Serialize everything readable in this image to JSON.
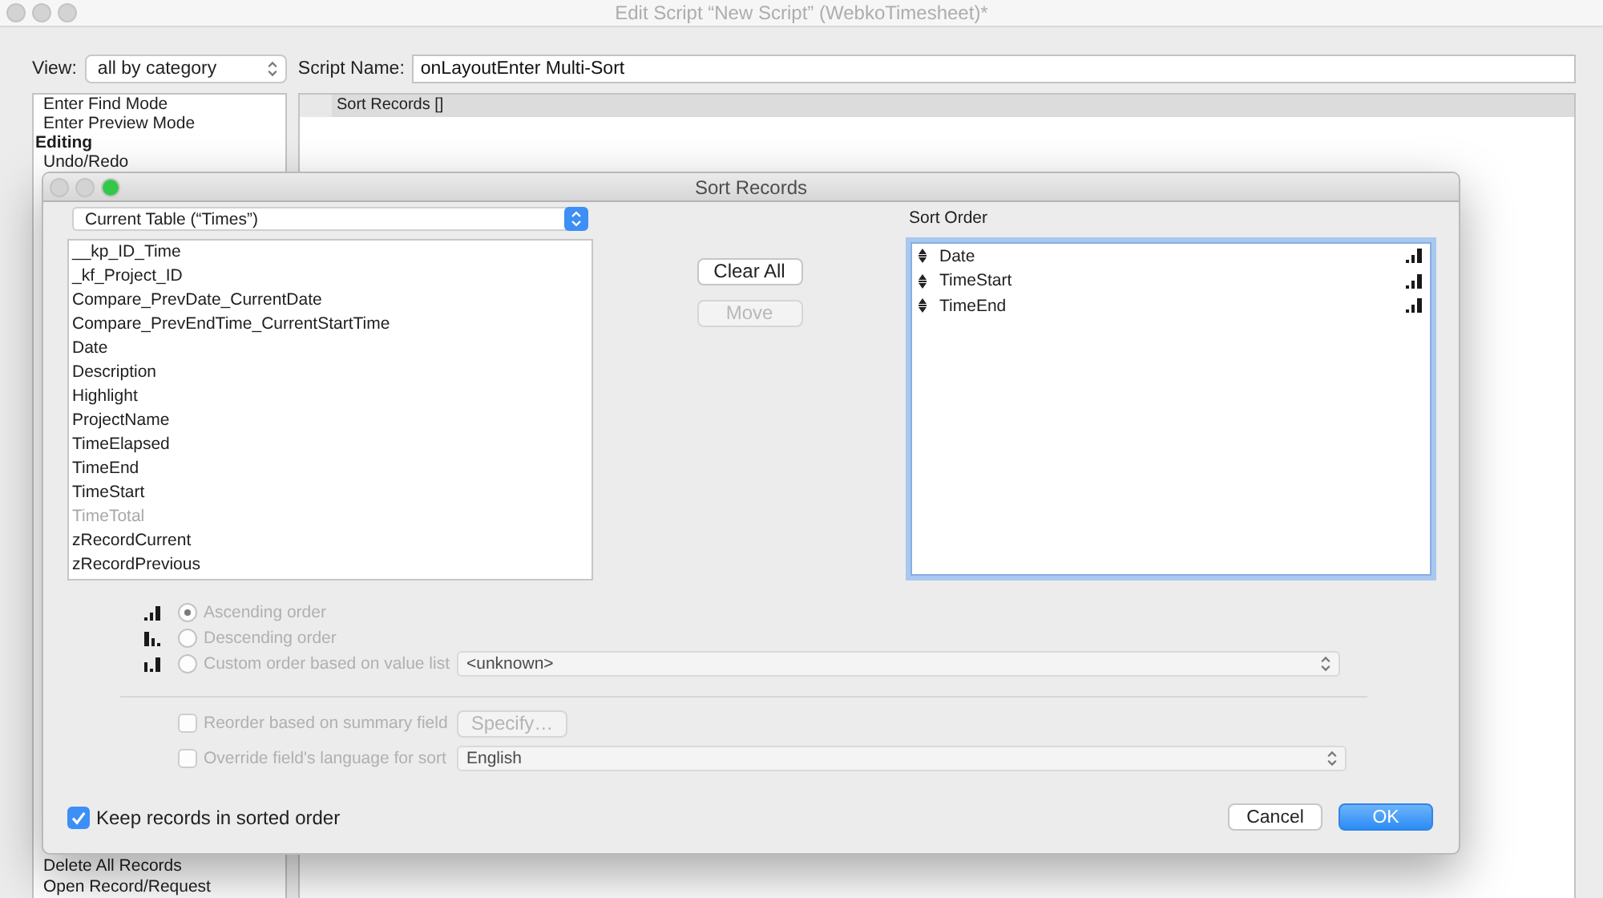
{
  "window": {
    "title": "Edit Script “New Script” (WebkoTimesheet)*",
    "active": false
  },
  "toolbar": {
    "view_label": "View:",
    "view_menu": "all by category",
    "script_name_label": "Script Name:",
    "script_name": "onLayoutEnter Multi-Sort"
  },
  "steps_list": {
    "items_top": [
      {
        "kind": "step",
        "label": "Enter Find Mode"
      },
      {
        "kind": "step",
        "label": "Enter Preview Mode"
      },
      {
        "kind": "category",
        "label": "Editing"
      },
      {
        "kind": "step",
        "label": "Undo/Redo"
      }
    ],
    "items_bottom": [
      {
        "kind": "step",
        "label": "Delete All Records"
      },
      {
        "kind": "step",
        "label": "Open Record/Request"
      }
    ]
  },
  "script": {
    "steps": [
      {
        "text": "Sort Records []",
        "selected": true
      }
    ]
  },
  "dialog": {
    "title": "Sort Records",
    "window_buttons": [
      {
        "kind": "close",
        "disabled": true
      },
      {
        "kind": "minimize",
        "disabled": true
      },
      {
        "kind": "zoom",
        "disabled": false
      }
    ],
    "table_menu": "Current Table (“Times”)",
    "fields": [
      {
        "name": "__kp_ID_Time",
        "disabled": false
      },
      {
        "name": "_kf_Project_ID",
        "disabled": false
      },
      {
        "name": "Compare_PrevDate_CurrentDate",
        "disabled": false
      },
      {
        "name": "Compare_PrevEndTime_CurrentStartTime",
        "disabled": false
      },
      {
        "name": "Date",
        "disabled": false
      },
      {
        "name": "Description",
        "disabled": false
      },
      {
        "name": "Highlight",
        "disabled": false
      },
      {
        "name": "ProjectName",
        "disabled": false
      },
      {
        "name": "TimeElapsed",
        "disabled": false
      },
      {
        "name": "TimeEnd",
        "disabled": false
      },
      {
        "name": "TimeStart",
        "disabled": false
      },
      {
        "name": "TimeTotal",
        "disabled": true
      },
      {
        "name": "zRecordCurrent",
        "disabled": false
      },
      {
        "name": "zRecordPrevious",
        "disabled": false
      }
    ],
    "clear_button": {
      "label": "Clear All",
      "disabled": false
    },
    "move_button": {
      "label": "Move",
      "disabled": true
    },
    "sort_order": {
      "label": "Sort Order",
      "items": [
        {
          "name": "Date",
          "descending": false
        },
        {
          "name": "TimeStart",
          "descending": false
        },
        {
          "name": "TimeEnd",
          "descending": false
        }
      ]
    },
    "order_options": [
      {
        "kind": "ascending",
        "label": "Ascending order",
        "selected": true,
        "disabled": true
      },
      {
        "kind": "descending",
        "label": "Descending order",
        "selected": false,
        "disabled": true
      },
      {
        "kind": "custom",
        "label": "Custom order based on value list",
        "selected": false,
        "disabled": true,
        "menu": "<unknown>"
      }
    ],
    "summary": {
      "label": "Reorder based on summary field",
      "checked": false,
      "disabled": true,
      "button": {
        "label": "Specify…",
        "disabled": true
      }
    },
    "language": {
      "label": "Override field's language for sort",
      "checked": false,
      "disabled": true,
      "menu": "English"
    },
    "keep_sorted": {
      "label": "Keep records in sorted order",
      "checked": true
    },
    "cancel_button": {
      "label": "Cancel",
      "default": false
    },
    "ok_button": {
      "label": "OK",
      "default": true
    }
  }
}
